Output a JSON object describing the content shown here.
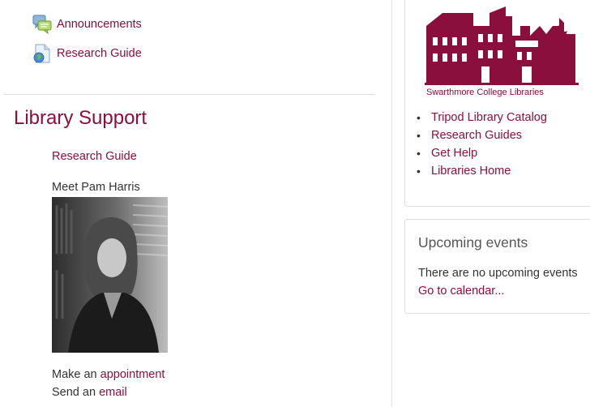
{
  "activities": [
    {
      "label": "Announcements",
      "icon": "forum-icon"
    },
    {
      "label": "Research Guide",
      "icon": "url-resource-icon"
    }
  ],
  "library_support": {
    "title": "Library Support",
    "research_guide_link": "Research Guide",
    "meet_text": "Meet Pam Harris",
    "make_an": "Make an",
    "appointment_link": "appointment",
    "send_an": "Send an",
    "email_link": "email"
  },
  "libraries_block": {
    "logo_caption": "Swarthmore College Libraries",
    "links": [
      "Tripod Library Catalog",
      "Research Guides",
      "Get Help",
      "Libraries Home"
    ]
  },
  "upcoming_events": {
    "title": "Upcoming events",
    "empty_text": "There are no upcoming events",
    "calendar_link": "Go to calendar..."
  },
  "colors": {
    "brand": "#8a0f3c",
    "text": "#333333",
    "border": "#dddddd"
  }
}
